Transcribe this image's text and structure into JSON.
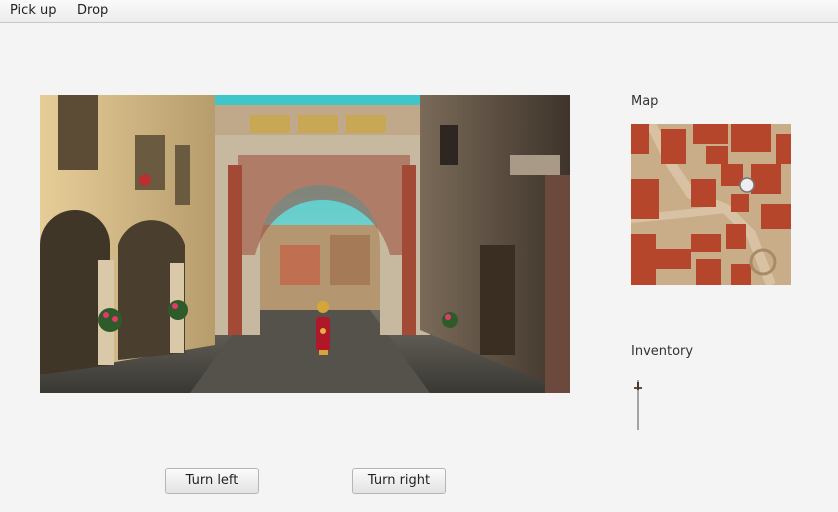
{
  "menu": {
    "pick_up": "Pick up",
    "drop": "Drop"
  },
  "map": {
    "label": "Map"
  },
  "inventory": {
    "label": "Inventory",
    "items": [
      "sword-icon"
    ]
  },
  "controls": {
    "turn_left": "Turn left",
    "turn_right": "Turn right"
  },
  "colors": {
    "background": "#f4f4f4",
    "roof": "#b5462c",
    "sky": "#4fc3c4"
  }
}
